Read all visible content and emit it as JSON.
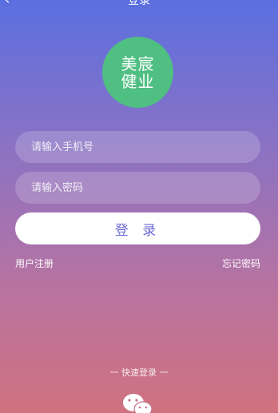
{
  "header": {
    "back_glyph": "‹",
    "title": "登录"
  },
  "logo": {
    "line1": "美宸",
    "line2": "健业",
    "color": "#4fbf82"
  },
  "form": {
    "phone_placeholder": "请输入手机号",
    "password_placeholder": "请输入密码",
    "login_label": "登 录"
  },
  "links": {
    "register": "用户注册",
    "forgot": "忘记密码"
  },
  "quick_login": {
    "label": "一 快速登录 一",
    "icon": "wechat-icon"
  }
}
